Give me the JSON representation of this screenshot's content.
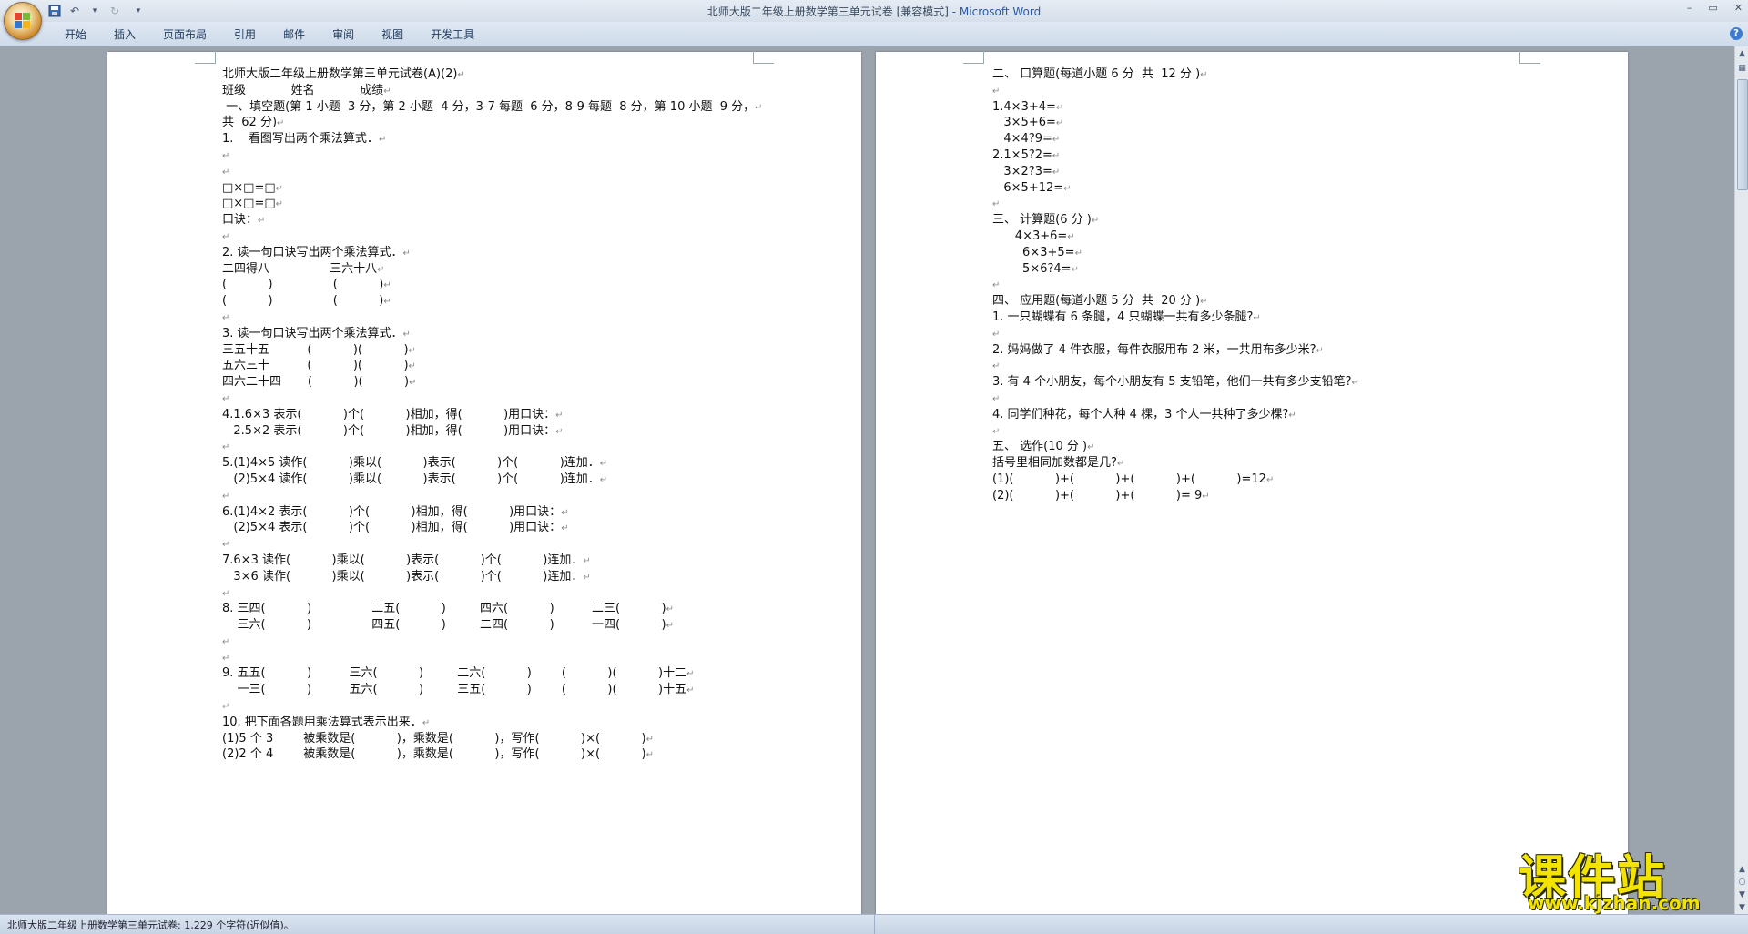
{
  "window": {
    "title": "北师大版二年级上册数学第三单元试卷 [兼容模式]",
    "app_name": " - Microsoft Word",
    "controls": [
      "–",
      "▭",
      "✕"
    ]
  },
  "quick_access": {
    "save_icon": "save-icon",
    "undo_icon": "undo-icon",
    "redo_icon": "redo-icon",
    "customize_icon": "customize-icon"
  },
  "ribbon": {
    "tabs": [
      "开始",
      "插入",
      "页面布局",
      "引用",
      "邮件",
      "审阅",
      "视图",
      "开发工具"
    ],
    "help": "?"
  },
  "page1": {
    "lines": [
      "北师大版二年级上册数学第三单元试卷(A)(2)",
      "班级            姓名            成绩",
      " 一、填空题(第 1 小题  3 分，第 2 小题  4 分，3-7 每题  6 分，8-9 每题  8 分，第 10 小题  9 分，",
      "共  62 分)",
      "1.    看图写出两个乘法算式．",
      "",
      "",
      "□×□=□",
      "□×□=□",
      "口诀：",
      "",
      "2. 读一句口诀写出两个乘法算式．",
      "二四得八                三六十八",
      "(           )                (           )",
      "(           )                (           )",
      "",
      "3. 读一句口诀写出两个乘法算式．",
      "三五十五          (           )(           )",
      "五六三十          (           )(           )",
      "四六二十四       (           )(           )",
      "",
      "4.1.6×3 表示(           )个(           )相加，得(           )用口诀：",
      "   2.5×2 表示(           )个(           )相加，得(           )用口诀：",
      "",
      "5.(1)4×5 读作(           )乘以(           )表示(           )个(           )连加．",
      "   (2)5×4 读作(           )乘以(           )表示(           )个(           )连加．",
      "",
      "6.(1)4×2 表示(           )个(           )相加，得(           )用口诀：",
      "   (2)5×4 表示(           )个(           )相加，得(           )用口诀：",
      "",
      "7.6×3 读作(           )乘以(           )表示(           )个(           )连加．",
      "   3×6 读作(           )乘以(           )表示(           )个(           )连加．",
      "",
      "8. 三四(           )                二五(           )         四六(           )          二三(           )",
      "    三六(           )                四五(           )         二四(           )          一四(           )",
      "",
      "",
      "9. 五五(           )          三六(           )         二六(           )        (           )(           )十二",
      "    一三(           )          五六(           )         三五(           )        (           )(           )十五",
      "",
      "10. 把下面各题用乘法算式表示出来．",
      "(1)5 个 3        被乘数是(           )，乘数是(           )，写作(           )×(           )",
      "(2)2 个 4        被乘数是(           )，乘数是(           )，写作(           )×(           )"
    ]
  },
  "page2": {
    "lines": [
      "二、 口算题(每道小题 6 分  共  12 分 )",
      "",
      "1.4×3+4=",
      "   3×5+6=",
      "   4×4?9=",
      "2.1×5?2=",
      "   3×2?3=",
      "   6×5+12=",
      "",
      "三、 计算题(6 分 )",
      "      4×3+6=",
      "        6×3+5=",
      "        5×6?4=",
      "",
      "四、 应用题(每道小题 5 分  共  20 分 )",
      "1. 一只蝴蝶有 6 条腿，4 只蝴蝶一共有多少条腿?",
      "",
      "2. 妈妈做了 4 件衣服，每件衣服用布 2 米，一共用布多少米?",
      "",
      "3. 有 4 个小朋友，每个小朋友有 5 支铅笔，他们一共有多少支铅笔?",
      "",
      "4. 同学们种花，每个人种 4 棵，3 个人一共种了多少棵?",
      "",
      "五、 选作(10 分 )",
      "括号里相同加数都是几?",
      "(1)(           )+(           )+(           )+(           )=12",
      "(2)(           )+(           )+(           )= 9"
    ]
  },
  "status": {
    "text": "北师大版二年级上册数学第三单元试卷: 1,229 个字符(近似值)。"
  },
  "watermark": {
    "big": "课件站",
    "small": "www.kjzhan.com"
  },
  "colors": {
    "app_blue": "#2a5aa8",
    "watermark_yellow": "#f3e400"
  }
}
